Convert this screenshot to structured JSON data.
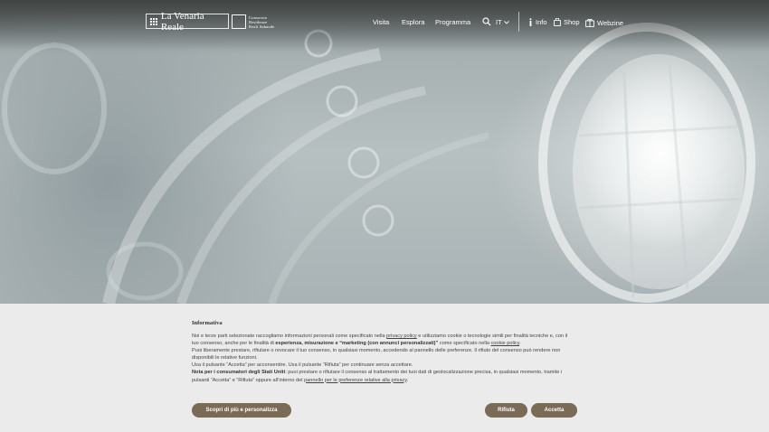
{
  "header": {
    "logo_text": "La Venaria Reale",
    "consorzio_lines": [
      "Consorzio",
      "Residenze",
      "Reali Sabaude"
    ],
    "nav": [
      "Visita",
      "Esplora",
      "Programma"
    ],
    "lang": "IT",
    "util": {
      "info": "Info",
      "shop": "Shop",
      "webzine": "Webzine"
    }
  },
  "cookie": {
    "title": "Informativa",
    "p1_a": "Noi e terze parti selezionate raccogliamo informazioni personali come specificato nella ",
    "p1_link": "privacy policy",
    "p1_b": " e utilizziamo cookie o tecnologie simili per finalità tecniche e, con il tuo consenso, anche per le finalità di ",
    "p1_bold": "esperienza, misurazione e “marketing (con annunci personalizzati)”",
    "p1_c": " come specificato nella ",
    "p1_link2": "cookie policy",
    "p1_d": ".",
    "p2": "Puoi liberamente prestare, rifiutare o revocare il tuo consenso, in qualsiasi momento, accedendo al pannello delle preferenze. Il rifiuto del consenso può rendere non disponibili le relative funzioni.",
    "p3": "Usa il pulsante “Accetta” per acconsentire. Usa il pulsante “Rifiuta” per continuare senza accettare.",
    "p4_bold": "Nota per i consumatori degli Stati Uniti",
    "p4_a": ": puoi prestare o rifiutare il consenso al trattamento dei tuoi dati di geolocalizzazione precisa, in qualsiasi momento, tramite i pulsanti “Accetta” e “Rifiuta” oppure all’interno del ",
    "p4_link": "pannello per le preferenze relative alla privacy",
    "p4_b": ".",
    "btn_more": "Scopri di più e personalizza",
    "btn_reject": "Rifiuta",
    "btn_accept": "Accetta"
  },
  "colors": {
    "button": "#7b6a55",
    "banner_bg": "#ebebeb"
  },
  "icons": [
    "search-icon",
    "chevron-down-icon",
    "info-icon",
    "shop-bag-icon",
    "webzine-icon"
  ]
}
